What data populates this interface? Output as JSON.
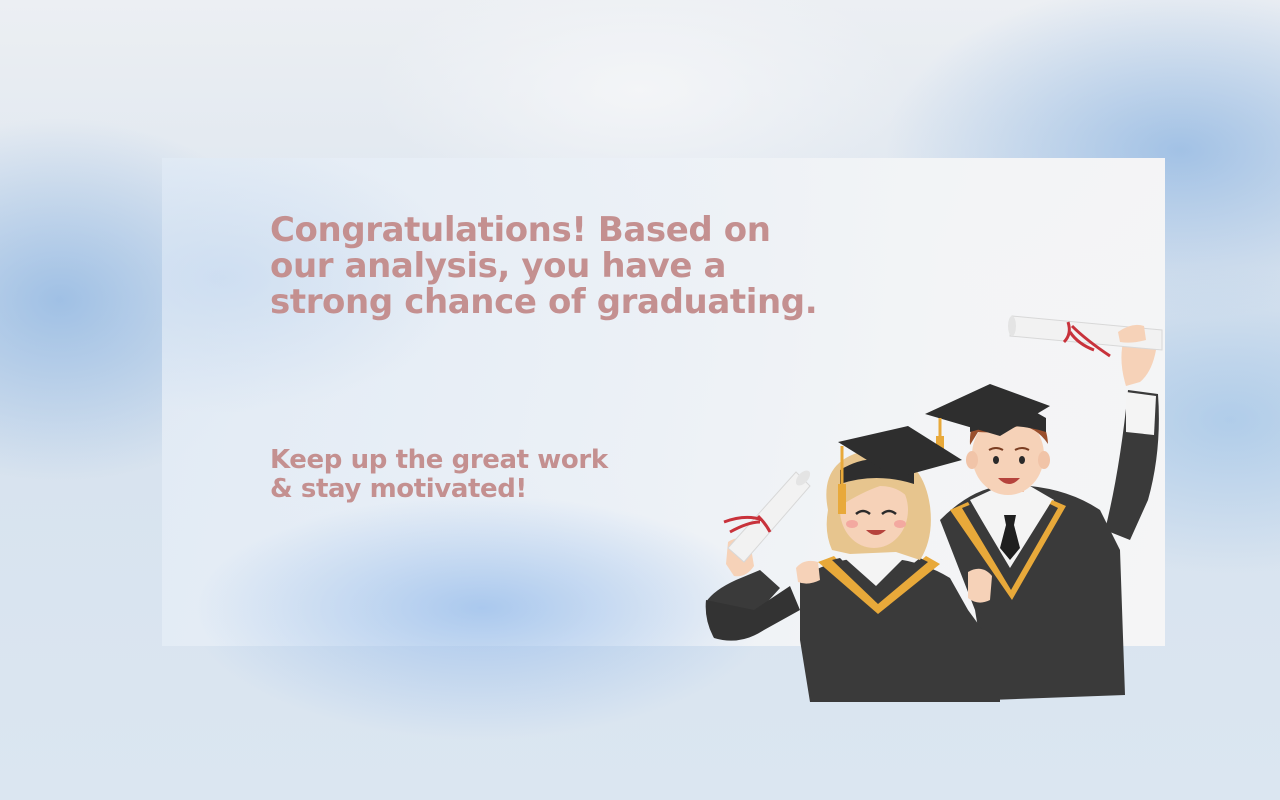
{
  "message": {
    "headline": "Congratulations! Based on our analysis, you have a strong chance of graduating.",
    "subtext_line1": "Keep up the great work",
    "subtext_line2": "& stay motivated!"
  },
  "illustration": {
    "icon": "graduates-illustration",
    "colors": {
      "gown": "#3a3a3a",
      "gown_trim": "#e8a93a",
      "cap": "#2e2e2e",
      "tassel": "#e8a93a",
      "skin": "#f6d2b8",
      "female_hair": "#e7c58e",
      "male_hair": "#9a4f2c",
      "diploma": "#f2f2f2",
      "ribbon": "#c8323b"
    }
  },
  "theme": {
    "text_color": "#c49090",
    "card_color": "#f3f4f6"
  }
}
